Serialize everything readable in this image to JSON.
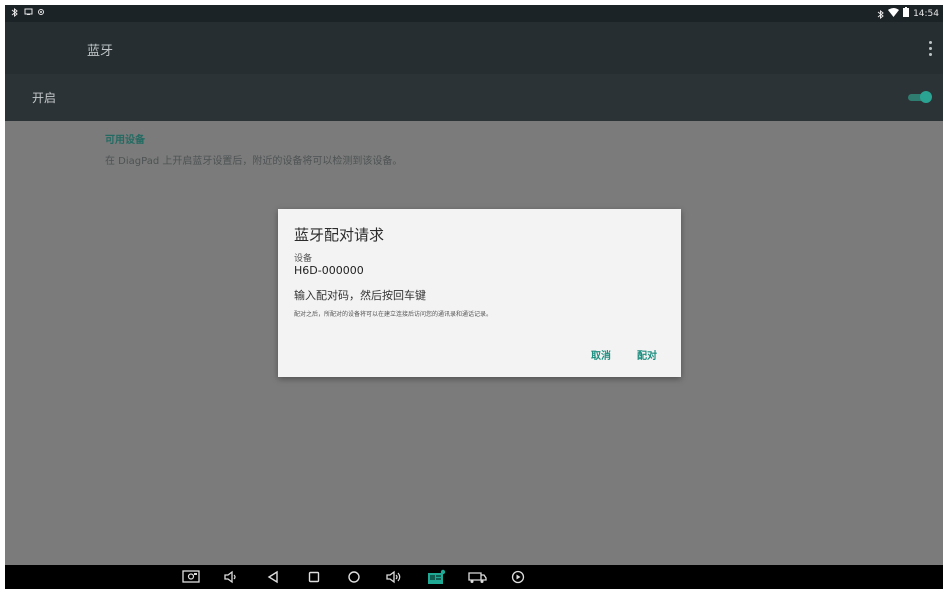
{
  "status_bar": {
    "time": "14:54",
    "left_icons": [
      "bluetooth-icon",
      "screen-icon",
      "sync-icon"
    ],
    "right_icons": [
      "bluetooth-icon",
      "wifi-icon",
      "battery-icon"
    ]
  },
  "app_bar": {
    "title": "蓝牙",
    "menu_icon": "overflow-menu-icon"
  },
  "switch_row": {
    "label": "开启",
    "state": "on",
    "accent": "#2aa393"
  },
  "content": {
    "section_header": "可用设备",
    "description": "在 DiagPad 上开启蓝牙设置后，附近的设备将可以检测到该设备。"
  },
  "dialog": {
    "title": "蓝牙配对请求",
    "device_label": "设备",
    "device_name": "H6D-000000",
    "instruction": "输入配对码，然后按回车键",
    "note": "配对之后，所配对的设备将可以在建立连接后访问您的通讯录和通话记录。",
    "cancel_label": "取消",
    "pair_label": "配对",
    "button_color": "#1f8f80"
  },
  "nav_bar": {
    "buttons": [
      "screenshot-icon",
      "volume-down-icon",
      "back-icon",
      "recents-icon",
      "home-icon",
      "volume-up-icon",
      "diagnostic-app-icon",
      "vehicle-icon",
      "play-icon"
    ],
    "highlight_color": "#1fa894"
  }
}
